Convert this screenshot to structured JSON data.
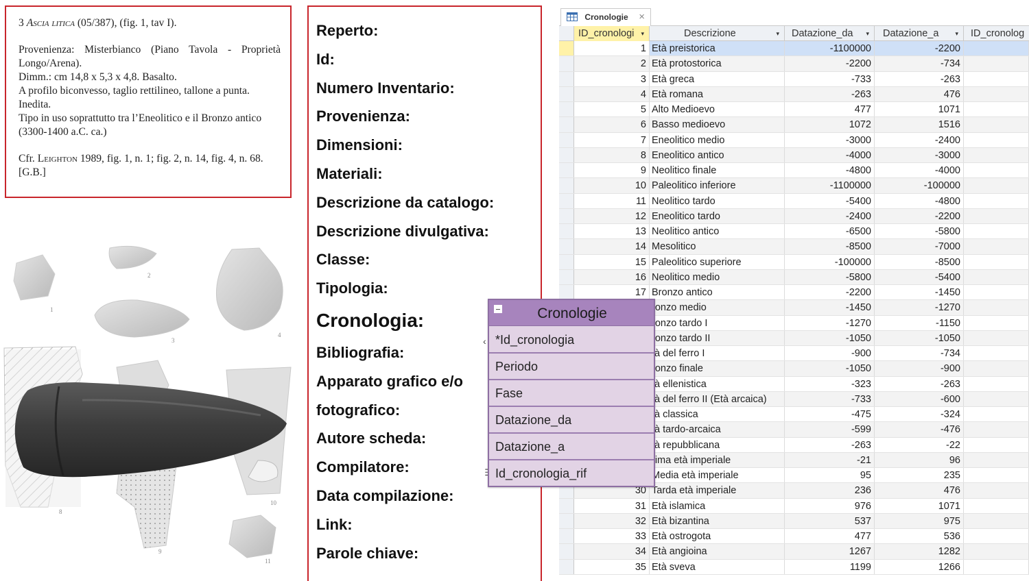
{
  "catalog_card": {
    "heading_number": "3 ",
    "heading_title": "Ascia litica",
    "heading_ref": " (05/387), (fig. 1, tav I).",
    "provenienza": "Provenienza: Misterbianco (Piano Tavola - Proprietà Longo/Arena).",
    "dimm": "Dimm.: cm 14,8 x 5,3 x 4,8. Basalto.",
    "profilo": "A profilo biconvesso, taglio rettilineo, tallone a punta.",
    "inedita": "Inedita.",
    "tipo": "Tipo in uso soprattutto tra l’Eneolitico e il Bronzo antico (3300-1400 a.C. ca.)",
    "cfr_prefix": "Cfr. ",
    "cfr_author": "Leighton",
    "cfr_rest": " 1989, fig. 1, n. 1; fig. 2, n. 14, fig. 4, n. 68.",
    "signature": "[G.B.]"
  },
  "plate": {
    "numbers": [
      "1",
      "2",
      "3",
      "4",
      "8",
      "10",
      "9",
      "11"
    ]
  },
  "schema_form": {
    "fields": [
      "Reperto:",
      "Id:",
      "Numero Inventario:",
      "Provenienza:",
      "Dimensioni:",
      "Materiali:",
      "Descrizione da catalogo:",
      "Descrizione divulgativa:",
      "Classe:",
      "Tipologia:",
      "Cronologia:",
      "Bibliografia:",
      "Apparato grafico e/o",
      "fotografico:",
      "Autore scheda:",
      "Compilatore:",
      "Data compilazione:",
      "Link:",
      "Parole chiave:"
    ]
  },
  "datasheet": {
    "tab_label": "Cronologie",
    "tab_close": "×",
    "columns": [
      "ID_cronologi",
      "Descrizione",
      "Datazione_da",
      "Datazione_a",
      "ID_cronolog"
    ],
    "sort_arrow": "▾",
    "rows": [
      {
        "id": "1",
        "desc": "Età preistorica",
        "da": "-1100000",
        "a": "-2200"
      },
      {
        "id": "2",
        "desc": "Età protostorica",
        "da": "-2200",
        "a": "-734"
      },
      {
        "id": "3",
        "desc": "Età greca",
        "da": "-733",
        "a": "-263"
      },
      {
        "id": "4",
        "desc": "Età romana",
        "da": "-263",
        "a": "476"
      },
      {
        "id": "5",
        "desc": "Alto Medioevo",
        "da": "477",
        "a": "1071"
      },
      {
        "id": "6",
        "desc": "Basso medioevo",
        "da": "1072",
        "a": "1516"
      },
      {
        "id": "7",
        "desc": "Eneolitico medio",
        "da": "-3000",
        "a": "-2400"
      },
      {
        "id": "8",
        "desc": "Eneolitico antico",
        "da": "-4000",
        "a": "-3000"
      },
      {
        "id": "9",
        "desc": "Neolitico finale",
        "da": "-4800",
        "a": "-4000"
      },
      {
        "id": "10",
        "desc": "Paleolitico inferiore",
        "da": "-1100000",
        "a": "-100000"
      },
      {
        "id": "11",
        "desc": "Neolitico tardo",
        "da": "-5400",
        "a": "-4800"
      },
      {
        "id": "12",
        "desc": "Eneolitico tardo",
        "da": "-2400",
        "a": "-2200"
      },
      {
        "id": "13",
        "desc": "Neolitico antico",
        "da": "-6500",
        "a": "-5800"
      },
      {
        "id": "14",
        "desc": "Mesolitico",
        "da": "-8500",
        "a": "-7000"
      },
      {
        "id": "15",
        "desc": "Paleolitico superiore",
        "da": "-100000",
        "a": "-8500"
      },
      {
        "id": "16",
        "desc": "Neolitico medio",
        "da": "-5800",
        "a": "-5400"
      },
      {
        "id": "17",
        "desc": "Bronzo antico",
        "da": "-2200",
        "a": "-1450"
      },
      {
        "id": "",
        "desc": "ronzo medio",
        "da": "-1450",
        "a": "-1270"
      },
      {
        "id": "",
        "desc": "ronzo tardo I",
        "da": "-1270",
        "a": "-1150"
      },
      {
        "id": "",
        "desc": "ronzo tardo II",
        "da": "-1050",
        "a": "-1050"
      },
      {
        "id": "",
        "desc": "tà del ferro I",
        "da": "-900",
        "a": "-734"
      },
      {
        "id": "",
        "desc": "ronzo finale",
        "da": "-1050",
        "a": "-900"
      },
      {
        "id": "",
        "desc": "tà ellenistica",
        "da": "-323",
        "a": "-263"
      },
      {
        "id": "",
        "desc": "tà del ferro II (Età arcaica)",
        "da": "-733",
        "a": "-600"
      },
      {
        "id": "",
        "desc": "tà classica",
        "da": "-475",
        "a": "-324"
      },
      {
        "id": "",
        "desc": "tà tardo-arcaica",
        "da": "-599",
        "a": "-476"
      },
      {
        "id": "",
        "desc": "tà repubblicana",
        "da": "-263",
        "a": "-22"
      },
      {
        "id": "",
        "desc": "rima età imperiale",
        "da": "-21",
        "a": "96"
      },
      {
        "id": "",
        "desc": "Media età imperiale",
        "da": "95",
        "a": "235"
      },
      {
        "id": "30",
        "desc": "Tarda età imperiale",
        "da": "236",
        "a": "476"
      },
      {
        "id": "31",
        "desc": "Età islamica",
        "da": "976",
        "a": "1071"
      },
      {
        "id": "32",
        "desc": "Età bizantina",
        "da": "537",
        "a": "975"
      },
      {
        "id": "33",
        "desc": "Età ostrogota",
        "da": "477",
        "a": "536"
      },
      {
        "id": "34",
        "desc": "Età angioina",
        "da": "1267",
        "a": "1282"
      },
      {
        "id": "35",
        "desc": "Età sveva",
        "da": "1199",
        "a": "1266"
      }
    ],
    "selected_row": 0
  },
  "entity": {
    "title": "Cronologie",
    "fields": [
      "*Id_cronologia",
      "Periodo",
      "Fase",
      "Datazione_da",
      "Datazione_a",
      "Id_cronologia_rif"
    ],
    "connector_top": "‹",
    "connector_bottom": "∃"
  },
  "colors": {
    "red_border": "#c8252b",
    "entity_fill": "#e2d3e5",
    "entity_header": "#a784bd",
    "row_selected": "#cfe0f7",
    "header_selected": "#fff2a8"
  }
}
